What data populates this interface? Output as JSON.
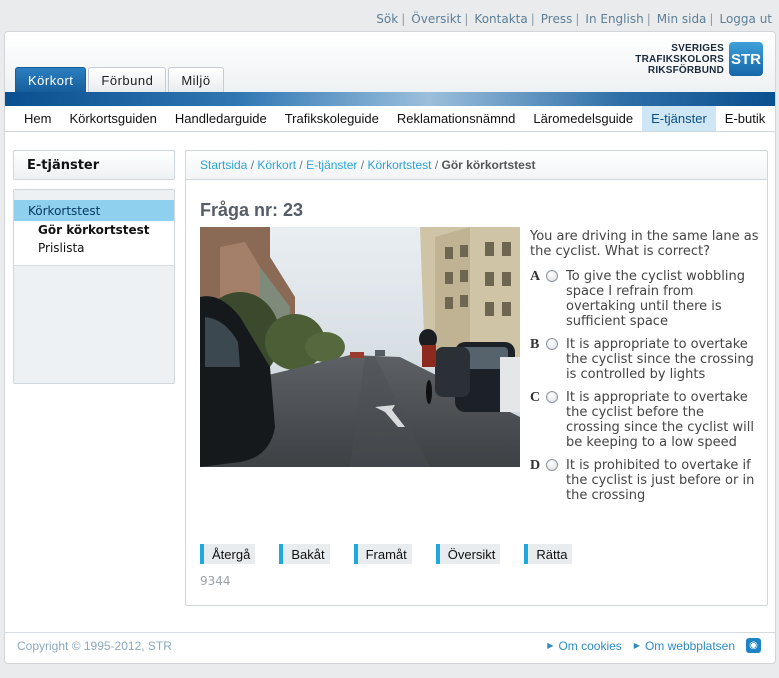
{
  "top_links": [
    "Sök",
    "Översikt",
    "Kontakta",
    "Press",
    "In English",
    "Min sida",
    "Logga ut"
  ],
  "logo": {
    "line1": "SVERIGES",
    "line2": "TRAFIKSKOLORS",
    "line3": "RIKSFÖRBUND",
    "mark": "STR"
  },
  "tabs": [
    {
      "label": "Körkort",
      "active": true
    },
    {
      "label": "Förbund",
      "active": false
    },
    {
      "label": "Miljö",
      "active": false
    }
  ],
  "nav": [
    "Hem",
    "Körkortsguiden",
    "Handledarguide",
    "Trafikskoleguide",
    "Reklamationsnämnd",
    "Läromedelsguide",
    "E-tjänster",
    "E-butik"
  ],
  "nav_active": "E-tjänster",
  "sidebar": {
    "title": "E-tjänster",
    "active": "Körkortstest",
    "subitems": [
      "Gör körkortstest",
      "Prislista"
    ]
  },
  "breadcrumb": {
    "items": [
      "Startsida",
      "Körkort",
      "E-tjänster",
      "Körkortstest"
    ],
    "current": "Gör körkortstest"
  },
  "question": {
    "title": "Fråga nr: 23",
    "text": "You are driving in the same lane as the cyclist. What is correct?",
    "answers": [
      {
        "letter": "A",
        "text": "To give the cyclist wobbling space I refrain from overtaking until there is sufficient space"
      },
      {
        "letter": "B",
        "text": "It is appropriate to overtake the cyclist since the crossing is controlled by lights"
      },
      {
        "letter": "C",
        "text": "It is appropriate to overtake the cyclist before the crossing since the cyclist will be keeping to a low speed"
      },
      {
        "letter": "D",
        "text": "It is prohibited to overtake if the cyclist is just before or in the crossing"
      }
    ]
  },
  "buttons": [
    "Återgå",
    "Bakåt",
    "Framåt",
    "Översikt",
    "Rätta"
  ],
  "code": "9344",
  "footer": {
    "copyright": "Copyright © 1995-2012, STR",
    "links": [
      "Om cookies",
      "Om webbplatsen"
    ]
  }
}
